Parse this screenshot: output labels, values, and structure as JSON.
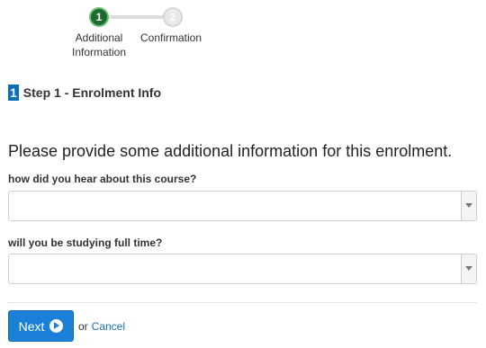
{
  "stepper": {
    "steps": [
      {
        "number": "1",
        "label": "Additional Information",
        "state": "active",
        "color": "#1d6b2f"
      },
      {
        "number": "2",
        "label": "Confirmation",
        "state": "inactive",
        "color": "#e9e9e9"
      }
    ]
  },
  "section": {
    "badge": "1",
    "title": "Step 1 - Enrolment Info"
  },
  "form": {
    "intro": "Please provide some additional information for this enrolment.",
    "fields": [
      {
        "label": "how did you hear about this course?",
        "value": ""
      },
      {
        "label": "will you be studying full time?",
        "value": ""
      }
    ]
  },
  "actions": {
    "next_label": "Next",
    "next_icon": "circle-arrow-right-icon",
    "or_text": "or",
    "cancel_label": "Cancel",
    "accent": "#1a80d8"
  }
}
